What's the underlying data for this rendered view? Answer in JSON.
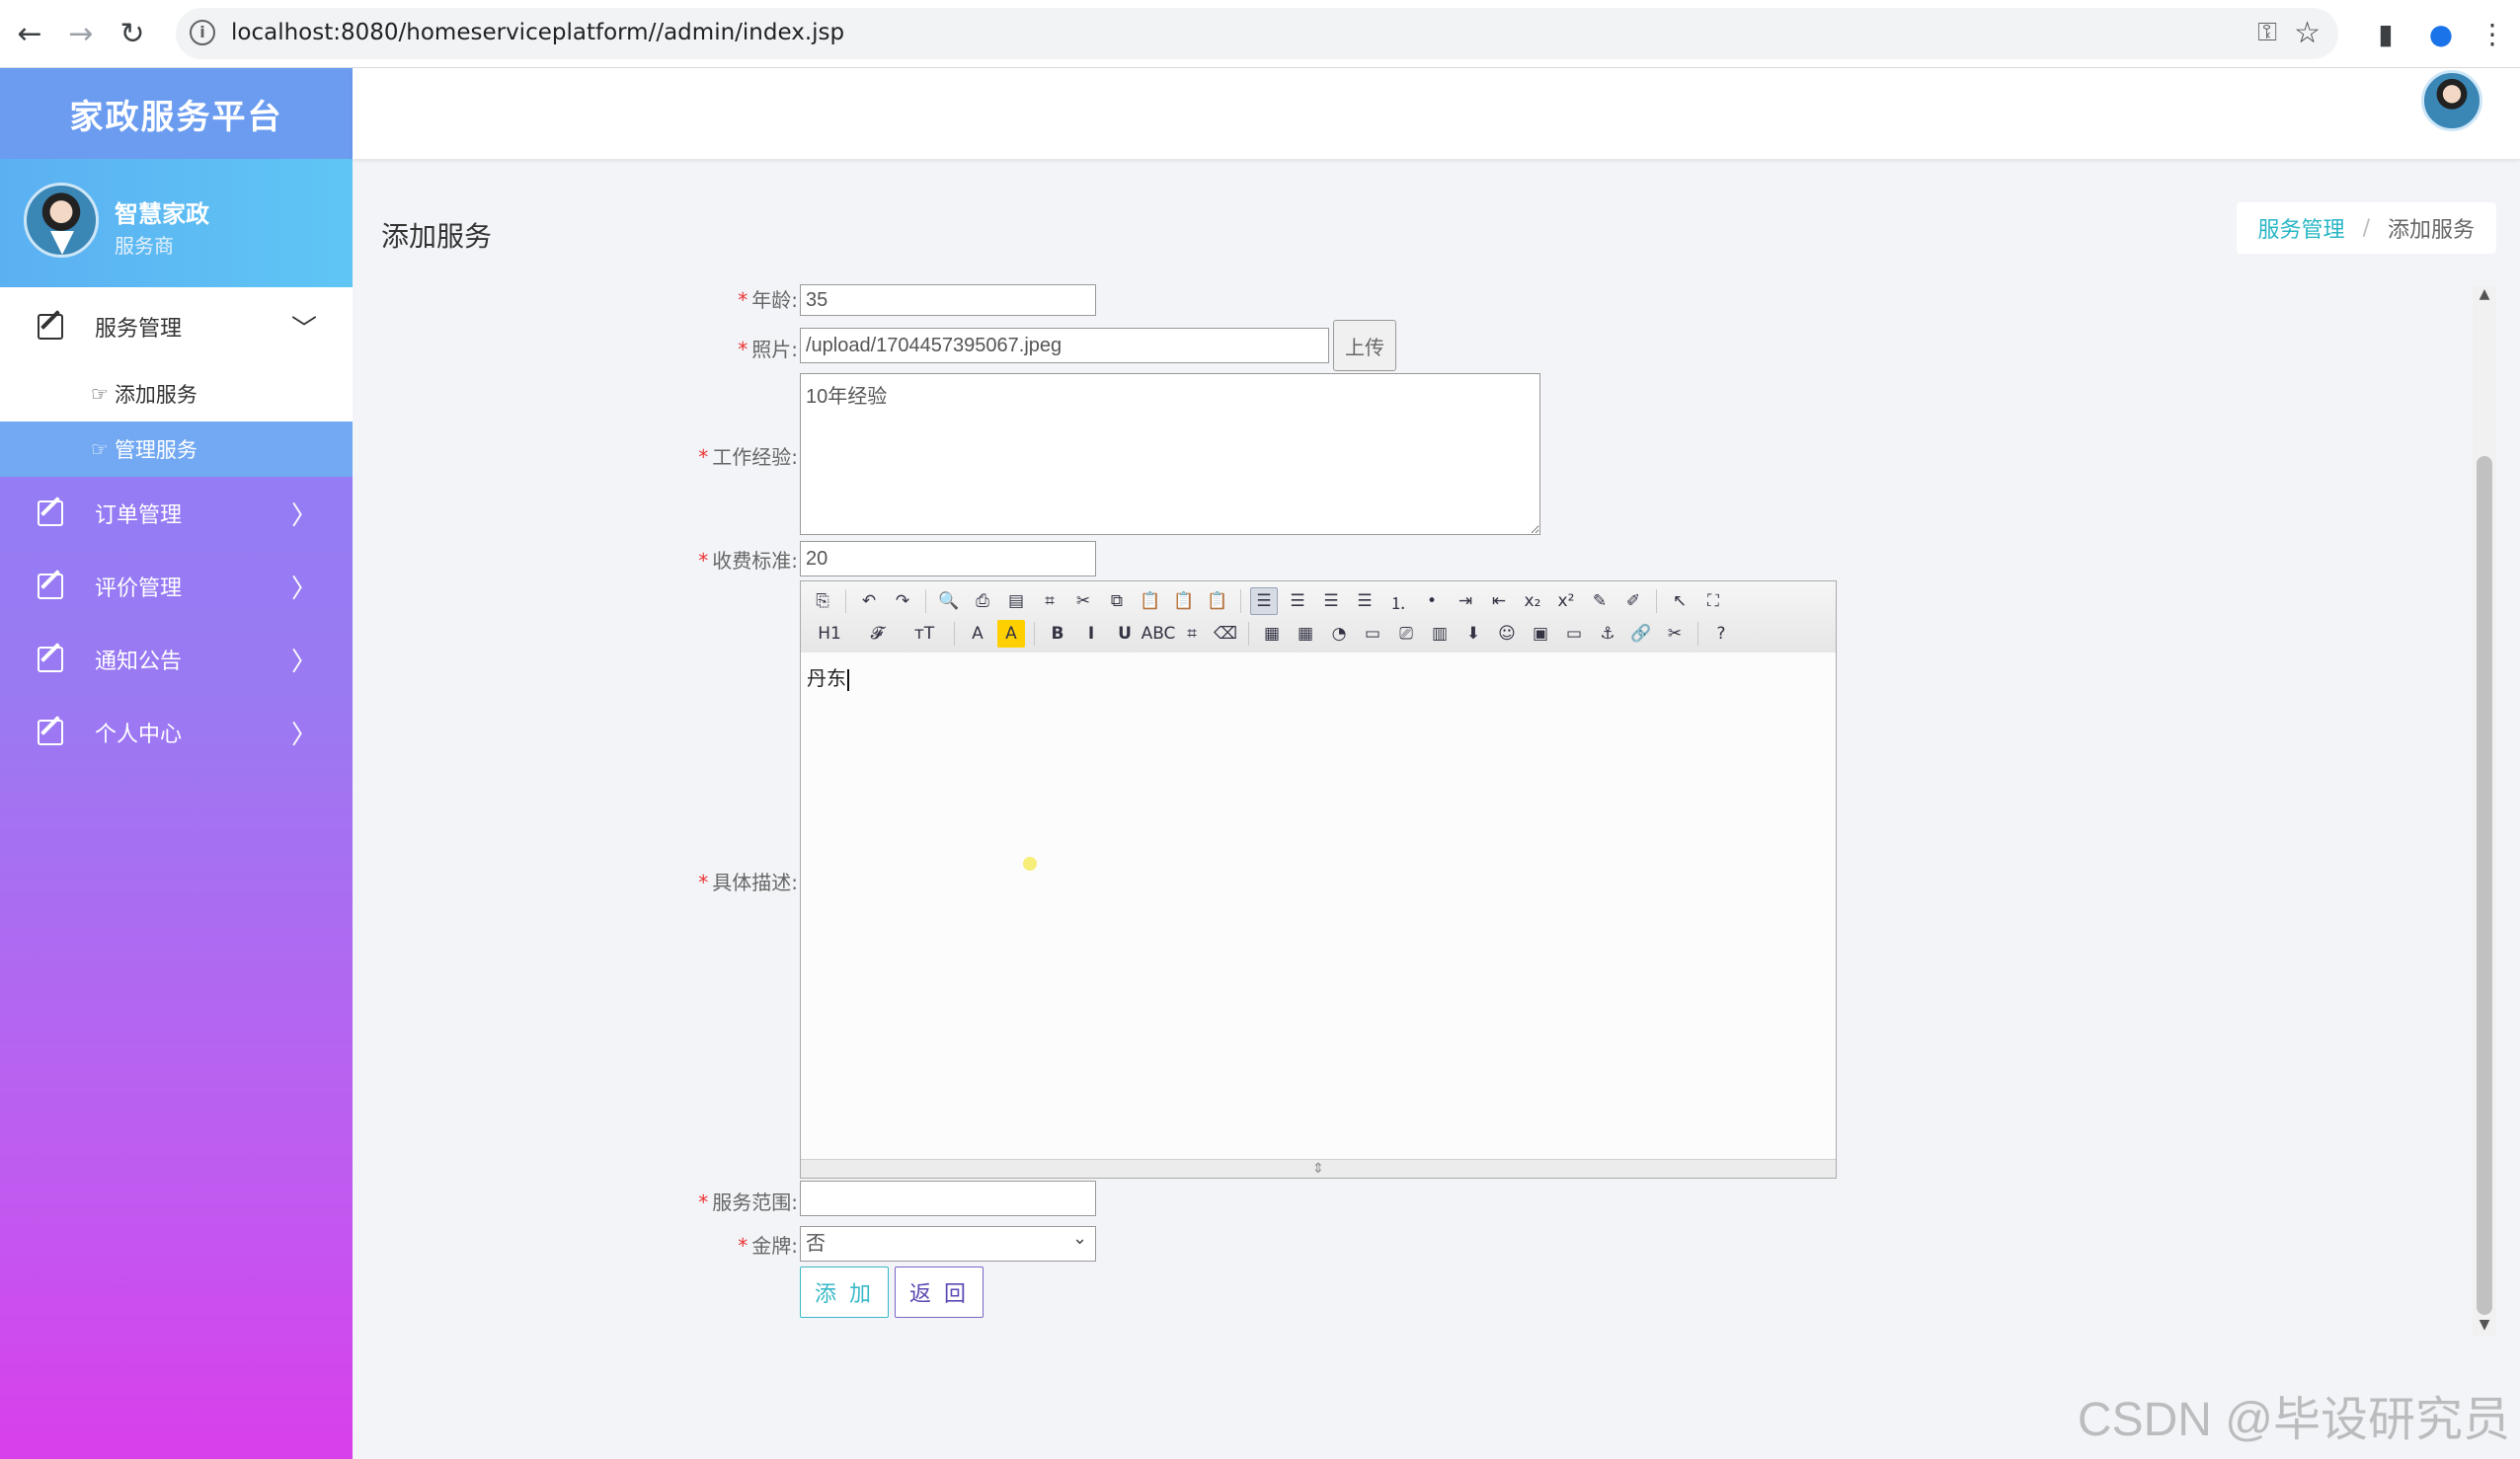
{
  "browser": {
    "url": "localhost:8080/homeserviceplatform//admin/index.jsp",
    "back_icon": "←",
    "forward_icon": "→",
    "reload_icon": "↻",
    "info_icon": "i",
    "key_icon": "⚿",
    "star_icon": "☆",
    "sidepanel_icon": "▮",
    "profile_icon": "●",
    "menu_icon": "⋮"
  },
  "sidebar": {
    "brand": "家政服务平台",
    "user_name": "智慧家政",
    "user_role": "服务商",
    "menu": [
      {
        "label": "服务管理",
        "arrow": "﹀"
      },
      {
        "label": "订单管理",
        "arrow": "〉"
      },
      {
        "label": "评价管理",
        "arrow": "〉"
      },
      {
        "label": "通知公告",
        "arrow": "〉"
      },
      {
        "label": "个人中心",
        "arrow": "〉"
      }
    ],
    "submenu": [
      {
        "label": "添加服务",
        "icon": "☞"
      },
      {
        "label": "管理服务",
        "icon": "☞"
      }
    ]
  },
  "page": {
    "title": "添加服务",
    "breadcrumb": {
      "parent": "服务管理",
      "sep": "/",
      "current": "添加服务"
    }
  },
  "form": {
    "required_mark": "*",
    "age": {
      "label": "年龄:",
      "value": "35"
    },
    "photo": {
      "label": "照片:",
      "value": "/upload/1704457395067.jpeg",
      "upload_label": "上传"
    },
    "experience": {
      "label": "工作经验:",
      "value": "10年经验"
    },
    "fee": {
      "label": "收费标准:",
      "value": "20"
    },
    "description": {
      "label": "具体描述:",
      "value": "丹东"
    },
    "scope": {
      "label": "服务范围:",
      "value": ""
    },
    "gold": {
      "label": "金牌:",
      "value": "否",
      "arrow": "⌄"
    },
    "add_label": "添 加",
    "back_label": "返 回"
  },
  "editor": {
    "row1": [
      "⎘",
      "↶",
      "↷",
      "🔍",
      "⎙",
      "▤",
      "⌗",
      "✂",
      "⧉",
      "📋",
      "📋",
      "📋",
      "☰",
      "☰",
      "☰",
      "☰",
      "⒈",
      "•",
      "⇥",
      "⇤",
      "x₂",
      "x²",
      "✎",
      "✐",
      "↖",
      "⛶"
    ],
    "row2": [
      "H1",
      "𝓕",
      "тT",
      "A",
      "A",
      "B",
      "I",
      "U",
      "ABC",
      "⌗",
      "⌫",
      "▦",
      "▦",
      "◔",
      "▭",
      "⎚",
      "▥",
      "⬇",
      "☺",
      "▣",
      "▭",
      "⚓",
      "🔗",
      "✂",
      "?"
    ],
    "foot": "⇕"
  },
  "scroll": {
    "up": "▲",
    "down": "▼"
  },
  "watermark": "CSDN @毕设研究员"
}
